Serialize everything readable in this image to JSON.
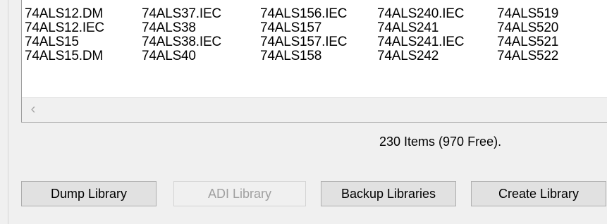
{
  "library_list": {
    "columns": [
      [
        "74ALS12.DM",
        "74ALS12.IEC",
        "74ALS15",
        "74ALS15.DM"
      ],
      [
        "74ALS37.IEC",
        "74ALS38",
        "74ALS38.IEC",
        "74ALS40"
      ],
      [
        "74ALS156.IEC",
        "74ALS157",
        "74ALS157.IEC",
        "74ALS158"
      ],
      [
        "74ALS240.IEC",
        "74ALS241",
        "74ALS241.IEC",
        "74ALS242"
      ],
      [
        "74ALS519",
        "74ALS520",
        "74ALS521",
        "74ALS522"
      ]
    ],
    "scroll_left_glyph": "‹"
  },
  "status": {
    "text": "230 Items (970 Free)."
  },
  "buttons": {
    "dump_label": "Dump Library",
    "adi_label": "ADI Library",
    "backup_label": "Backup Libraries",
    "create_label": "Create Library"
  },
  "colors": {
    "window_bg": "#f0f0f0",
    "list_bg": "#ffffff",
    "button_bg": "#e1e1e1",
    "disabled_text": "#a0a0a0"
  }
}
